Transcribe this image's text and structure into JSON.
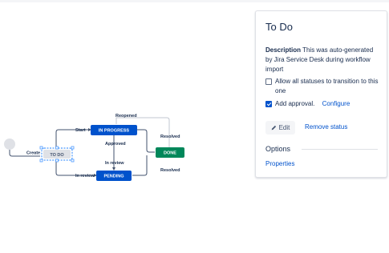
{
  "diagram": {
    "statuses": {
      "todo": "TO DO",
      "in_progress": "IN PROGRESS",
      "done": "DONE",
      "pending": "PENDING"
    },
    "transitions": {
      "create": "Create",
      "start": "Start",
      "reopened": "Reopened",
      "approved": "Approved",
      "resolved_top": "Resolved",
      "in_review_mid": "In review",
      "resolved_bottom": "Resolved",
      "in_review_bottom": "In review"
    },
    "colors": {
      "in_progress": "#0052cc",
      "pending": "#0052cc",
      "done": "#00875a",
      "todo": "#dfe1e6",
      "selection": "#4c9aff"
    }
  },
  "panel": {
    "title": "To Do",
    "description_label": "Description",
    "description_text": " This was auto-generated by Jira Service Desk during workflow import",
    "allow_all_label": "Allow all statuses to transition to this one",
    "allow_all_checked": false,
    "add_approval_label": "Add approval.",
    "add_approval_checked": true,
    "configure_label": "Configure",
    "edit_label": "Edit",
    "edit_icon": "pencil-icon",
    "remove_label": "Remove status",
    "options_heading": "Options",
    "properties_label": "Properties"
  }
}
